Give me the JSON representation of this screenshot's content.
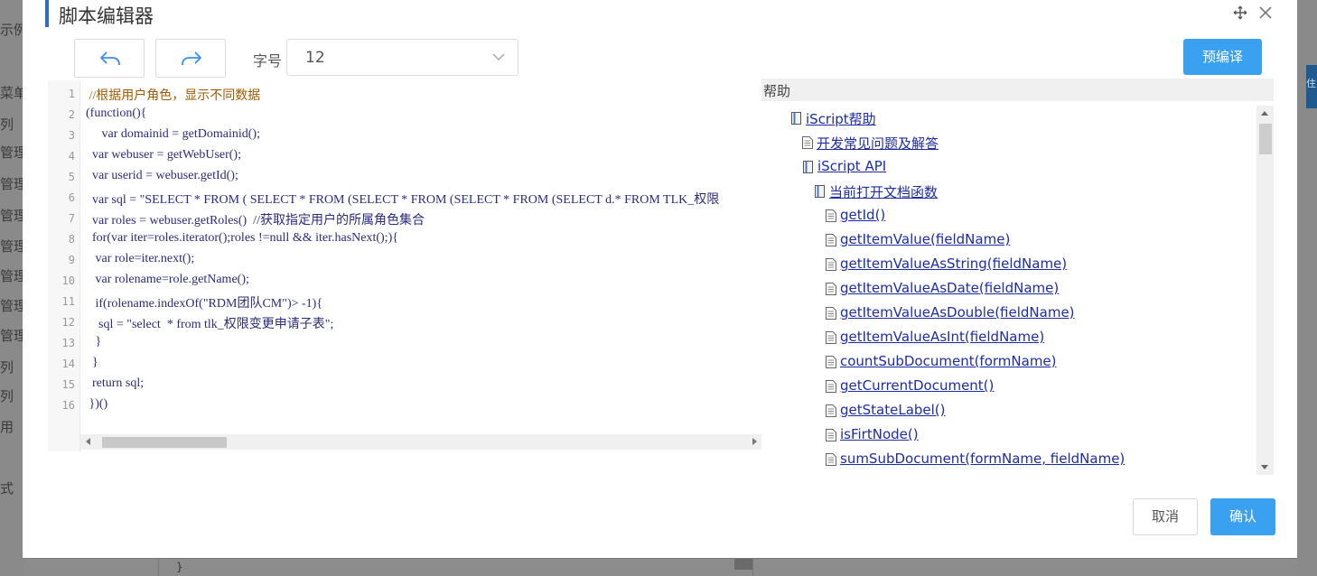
{
  "background": {
    "left_labels": [
      "示例",
      "菜单",
      "列",
      "管理控",
      "管理控",
      "管理控",
      "管理控",
      "管理控",
      "管理控",
      "管理控",
      "列",
      "列",
      "用",
      "式"
    ],
    "right_button": "住",
    "bottom_code": "}"
  },
  "dialog": {
    "title": "脚本编辑器",
    "font_label": "字号",
    "font_size": "12",
    "precompile_label": "预编译",
    "cancel_label": "取消",
    "confirm_label": "确认",
    "help_title": "帮助"
  },
  "editor": {
    "line_numbers": [
      "1",
      "2",
      "3",
      "4",
      "5",
      "6",
      "7",
      "8",
      "9",
      "10",
      "11",
      "12",
      "13",
      "14",
      "15",
      "16"
    ],
    "lines": [
      " //根据用户角色，显示不同数据",
      "(function(){",
      "     var domainid = getDomainid();",
      "  var webuser = getWebUser();",
      "  var userid = webuser.getId();",
      "  var sql = \"SELECT * FROM ( SELECT * FROM (SELECT * FROM (SELECT * FROM (SELECT d.* FROM TLK_权限",
      "  var roles = webuser.getRoles()  //获取指定用户的所属角色集合",
      "  for(var iter=roles.iterator();roles !=null && iter.hasNext();){",
      "   var role=iter.next();",
      "   var rolename=role.getName();",
      "   if(rolename.indexOf(\"RDM团队CM\")> -1){",
      "    sql = \"select  * from tlk_权限变更申请子表\";",
      "   }",
      "  }",
      "  return sql;",
      " })()"
    ]
  },
  "help": {
    "items": [
      {
        "label": "iScript帮助"
      },
      {
        "label": "开发常见问题及解答"
      },
      {
        "label": "iScript API"
      },
      {
        "label": "当前打开文档函数"
      },
      {
        "label": "getId()"
      },
      {
        "label": "getItemValue(fieldName)"
      },
      {
        "label": "getItemValueAsString(fieldName)"
      },
      {
        "label": "getItemValueAsDate(fieldName)"
      },
      {
        "label": "getItemValueAsDouble(fieldName)"
      },
      {
        "label": "getItemValueAsInt(fieldName)"
      },
      {
        "label": "countSubDocument(formName)"
      },
      {
        "label": "getCurrentDocument()"
      },
      {
        "label": "getStateLabel()"
      },
      {
        "label": "isFirtNode()"
      },
      {
        "label": "sumSubDocument(formName, fieldName)"
      }
    ]
  },
  "colors": {
    "accent": "#3aa0f0",
    "title_accent": "#2f6ebd",
    "link": "#1d2ca8",
    "comment": "#a05a00",
    "code": "#2b2b80"
  }
}
